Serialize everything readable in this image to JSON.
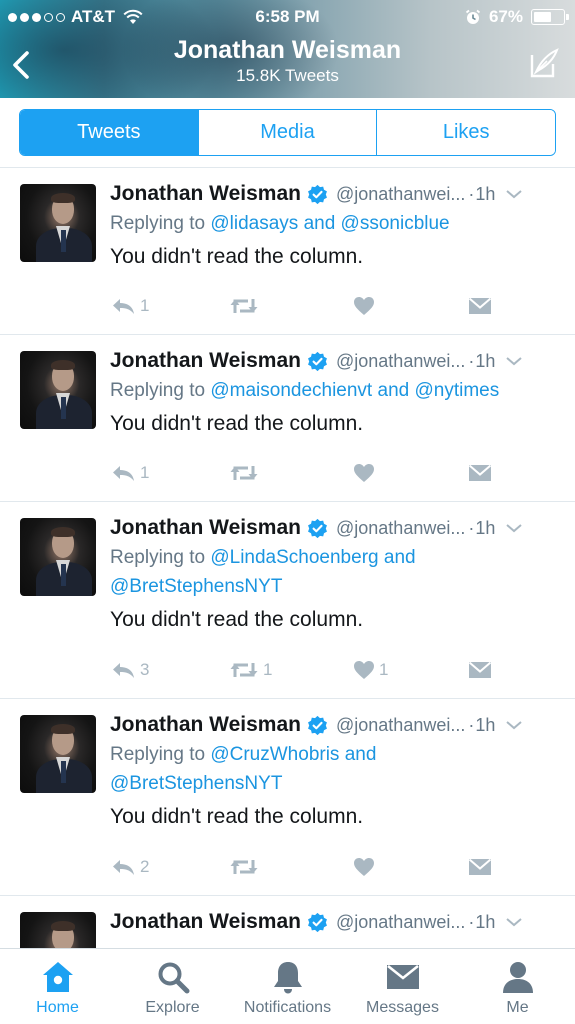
{
  "status_bar": {
    "carrier": "AT&T",
    "time": "6:58 PM",
    "battery": "67%",
    "battery_level": 0.67,
    "signal_bars_filled": 3,
    "signal_bars_total": 5
  },
  "header": {
    "name": "Jonathan Weisman",
    "tweet_count": "15.8K Tweets"
  },
  "segments": [
    {
      "label": "Tweets",
      "active": true
    },
    {
      "label": "Media",
      "active": false
    },
    {
      "label": "Likes",
      "active": false
    }
  ],
  "tweets": [
    {
      "name": "Jonathan Weisman",
      "handle": "@jonathanwei...",
      "separator": "·",
      "time": "1h",
      "reply_prefix": "Replying to",
      "reply_mention_1": "@lidasays",
      "reply_and": "and",
      "reply_mention_2": "@ssonicblue",
      "text": "You didn't read the column.",
      "replies": "1",
      "retweets": "",
      "likes": ""
    },
    {
      "name": "Jonathan Weisman",
      "handle": "@jonathanwei...",
      "separator": "·",
      "time": "1h",
      "reply_prefix": "Replying to",
      "reply_mention_1": "@maisondechienvt",
      "reply_and": "and",
      "reply_mention_2": "@nytimes",
      "text": "You didn't read the column.",
      "replies": "1",
      "retweets": "",
      "likes": ""
    },
    {
      "name": "Jonathan Weisman",
      "handle": "@jonathanwei...",
      "separator": "·",
      "time": "1h",
      "reply_prefix": "Replying to",
      "reply_mention_1": "@LindaSchoenberg",
      "reply_and": "and",
      "reply_mention_2": "@BretStephensNYT",
      "text": "You didn't read the column.",
      "replies": "3",
      "retweets": "1",
      "likes": "1"
    },
    {
      "name": "Jonathan Weisman",
      "handle": "@jonathanwei...",
      "separator": "·",
      "time": "1h",
      "reply_prefix": "Replying to",
      "reply_mention_1": "@CruzWhobris",
      "reply_and": "and",
      "reply_mention_2": "@BretStephensNYT",
      "text": "You didn't read the column.",
      "replies": "2",
      "retweets": "",
      "likes": ""
    },
    {
      "name": "Jonathan Weisman",
      "handle": "@jonathanwei...",
      "separator": "·",
      "time": "1h"
    }
  ],
  "tabbar": [
    {
      "label": "Home",
      "icon": "home-icon",
      "active": true
    },
    {
      "label": "Explore",
      "icon": "search-icon",
      "active": false
    },
    {
      "label": "Notifications",
      "icon": "bell-icon",
      "active": false
    },
    {
      "label": "Messages",
      "icon": "envelope-icon",
      "active": false
    },
    {
      "label": "Me",
      "icon": "person-icon",
      "active": false
    }
  ],
  "colors": {
    "accent": "#1da1f2",
    "mention": "#1b95e0",
    "muted": "#657786",
    "action_gray": "#aab8c2"
  }
}
